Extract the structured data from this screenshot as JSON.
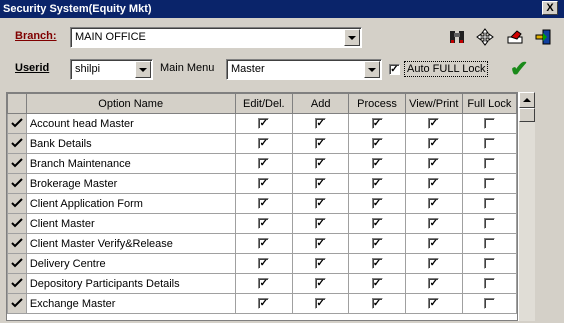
{
  "window": {
    "title": "Security System(Equity Mkt)",
    "close": "X"
  },
  "branch": {
    "label": "Branch:",
    "value": "MAIN OFFICE"
  },
  "userid": {
    "label": "Userid",
    "value": "shilpi"
  },
  "main_menu": {
    "label": "Main Menu",
    "value": "Master"
  },
  "auto_full_lock": {
    "label": "Auto FULL Lock",
    "checked": true
  },
  "toolbar": {
    "icons": [
      "binoculars-icon",
      "move-icon",
      "eraser-icon",
      "exit-icon"
    ],
    "confirm": "✔"
  },
  "grid": {
    "columns": [
      "",
      "Option Name",
      "Edit/Del.",
      "Add",
      "Process",
      "View/Print",
      "Full Lock"
    ],
    "rows": [
      {
        "name": "Account head Master",
        "edit": true,
        "add": true,
        "process": true,
        "view": true,
        "lock": false
      },
      {
        "name": "Bank Details",
        "edit": true,
        "add": true,
        "process": true,
        "view": true,
        "lock": false
      },
      {
        "name": "Branch Maintenance",
        "edit": true,
        "add": true,
        "process": true,
        "view": true,
        "lock": false
      },
      {
        "name": "Brokerage Master",
        "edit": true,
        "add": true,
        "process": true,
        "view": true,
        "lock": false
      },
      {
        "name": "Client Application Form",
        "edit": true,
        "add": true,
        "process": true,
        "view": true,
        "lock": false
      },
      {
        "name": "Client Master",
        "edit": true,
        "add": true,
        "process": true,
        "view": true,
        "lock": false
      },
      {
        "name": "Client Master Verify&Release",
        "edit": true,
        "add": true,
        "process": true,
        "view": true,
        "lock": false
      },
      {
        "name": "Delivery Centre",
        "edit": true,
        "add": true,
        "process": true,
        "view": true,
        "lock": false
      },
      {
        "name": "Depository Participants Details",
        "edit": true,
        "add": true,
        "process": true,
        "view": true,
        "lock": false
      },
      {
        "name": "Exchange Master",
        "edit": true,
        "add": true,
        "process": true,
        "view": true,
        "lock": false
      }
    ]
  },
  "colors": {
    "title_bg": "#0a246a",
    "label_red": "#800000",
    "check_green": "#1a8a1a"
  }
}
